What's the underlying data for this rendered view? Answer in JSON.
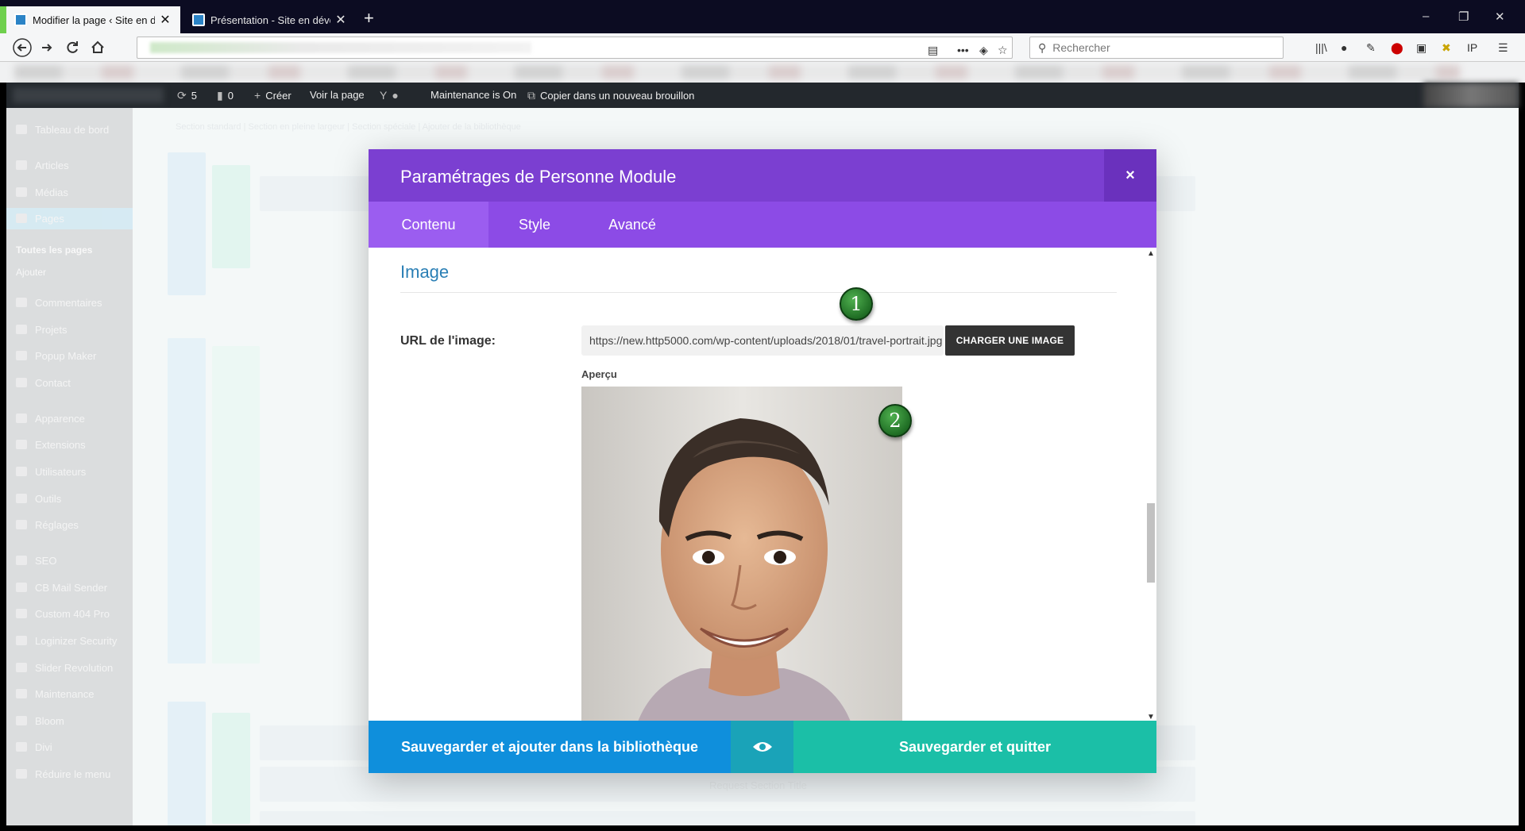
{
  "browser": {
    "tabs": [
      {
        "title": "Modifier la page ‹ Site en dével",
        "active": true,
        "close": "✕"
      },
      {
        "title": "Présentation - Site en développ",
        "active": false,
        "close": "✕"
      }
    ],
    "new_tab_icon": "+",
    "window_controls": [
      "–",
      "❐",
      "✕"
    ],
    "nav_icons": [
      "back-arrow-icon",
      "forward-arrow-icon",
      "reload-icon",
      "home-icon"
    ],
    "search_placeholder": "Rechercher"
  },
  "adminbar": {
    "updates_count": "5",
    "comments_count": "0",
    "create_label": "Créer",
    "view_page_label": "Voir la page",
    "maintenance_label": "Maintenance is On",
    "copy_draft_label": "Copier dans un nouveau brouillon"
  },
  "sidebar": {
    "items": [
      {
        "label": "Tableau de bord",
        "icon": "dashboard-icon"
      },
      {
        "label": "Articles",
        "icon": "pin-icon"
      },
      {
        "label": "Médias",
        "icon": "media-icon"
      },
      {
        "label": "Pages",
        "icon": "page-icon",
        "active": true
      },
      {
        "label": "Commentaires",
        "icon": "comment-icon"
      },
      {
        "label": "Projets",
        "icon": "pin-icon"
      },
      {
        "label": "Popup Maker",
        "icon": "popup-icon"
      },
      {
        "label": "Contact",
        "icon": "mail-icon"
      },
      {
        "label": "Apparence",
        "icon": "brush-icon"
      },
      {
        "label": "Extensions",
        "icon": "plugin-icon"
      },
      {
        "label": "Utilisateurs",
        "icon": "user-icon"
      },
      {
        "label": "Outils",
        "icon": "wrench-icon"
      },
      {
        "label": "Réglages",
        "icon": "settings-icon"
      },
      {
        "label": "SEO",
        "icon": "seo-icon"
      },
      {
        "label": "CB Mail Sender",
        "icon": "mail-icon"
      },
      {
        "label": "Custom 404 Pro",
        "icon": "chart-icon"
      },
      {
        "label": "Loginizer Security",
        "icon": "gear-icon"
      },
      {
        "label": "Slider Revolution",
        "icon": "refresh-icon"
      },
      {
        "label": "Maintenance",
        "icon": "wrench-icon"
      },
      {
        "label": "Bloom",
        "icon": "flower-icon"
      },
      {
        "label": "Divi",
        "icon": "divi-icon"
      },
      {
        "label": "Réduire le menu",
        "icon": "collapse-icon"
      }
    ],
    "subitems": [
      "Toutes les pages",
      "Ajouter"
    ]
  },
  "builder_ghost": {
    "section_links": "Section standard  |  Section en pleine largeur  |  Section spéciale  |  Ajouter de la bibliothèque",
    "request_title": "Request Section Title"
  },
  "modal": {
    "title": "Paramétrages de Personne Module",
    "close_icon": "×",
    "tabs": [
      "Contenu",
      "Style",
      "Avancé"
    ],
    "section_title": "Image",
    "url_label": "URL de l'image:",
    "url_value": "https://new.http5000.com/wp-content/uploads/2018/01/travel-portrait.jpg",
    "upload_button": "CHARGER UNE IMAGE",
    "preview_label": "Aperçu",
    "annotations": [
      "1",
      "2"
    ],
    "footer": {
      "save_library": "Sauvegarder et ajouter dans la bibliothèque",
      "preview_icon": "eye-icon",
      "save_quit": "Sauvegarder et quitter"
    }
  },
  "colors": {
    "modal_header": "#7b3fd1",
    "modal_tabs": "#8c4be6",
    "save_library": "#0f8fdc",
    "save_quit": "#1bbfa7",
    "section_title": "#2a7fb5"
  }
}
